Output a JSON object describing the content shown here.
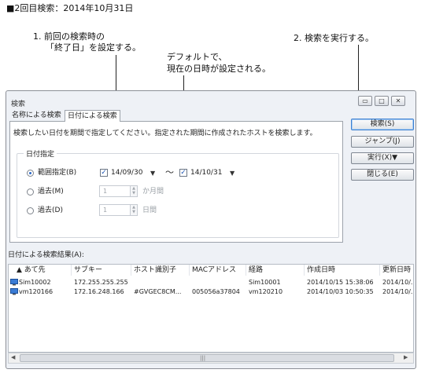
{
  "heading": "■2回目検索：2014年10月31日",
  "annotations": {
    "a1_line1": "1. 前回の検索時の",
    "a1_line2": "「終了日」を設定する。",
    "a2_line1": "デフォルトで、",
    "a2_line2": "現在の日時が設定される。",
    "a3": "2. 検索を実行する。"
  },
  "window": {
    "title": "検索",
    "controls": {
      "minimize": "▭",
      "maximize": "□",
      "close": "✕"
    }
  },
  "tabs": [
    {
      "label": "名称による検索",
      "active": false
    },
    {
      "label": "日付による検索",
      "active": true
    }
  ],
  "panel": {
    "description": "検索したい日付を期間で指定してください。指定された期間に作成されたホストを検索します。",
    "group_title": "日付指定",
    "range_label": "範囲指定(B)",
    "range_selected": true,
    "start_date": "14/09/30",
    "end_date": "14/10/31",
    "tilde": "〜",
    "past_months_label": "過去(M)",
    "past_months_value": "1",
    "months_unit": "か月間",
    "past_days_label": "過去(D)",
    "past_days_value": "1",
    "days_unit": "日間"
  },
  "buttons": {
    "search": "検索(S)",
    "jump": "ジャンプ(J)",
    "execute": "実行(X)▼",
    "close": "閉じる(E)"
  },
  "results": {
    "title": "日付による検索結果(A):",
    "columns": [
      "あて先",
      "サブキー",
      "ホスト識別子",
      "MACアドレス",
      "経路",
      "作成日時",
      "更新日時"
    ],
    "rows": [
      [
        "Sim10002",
        "172.255.255.255",
        "",
        "",
        "Sim10001",
        "2014/10/15 15:38:06",
        "2014/10/..."
      ],
      [
        "vm120166",
        "172.16.248.166",
        "#GVGEC8CM...",
        "005056a37804",
        "vm120210",
        "2014/10/03 10:50:35",
        "2014/10/..."
      ]
    ]
  },
  "scroll": {
    "left": "◀",
    "right": "▶",
    "grip": "|||"
  },
  "colors": {
    "accent": "#2b68c8",
    "window_bg": "#eef1f6"
  }
}
